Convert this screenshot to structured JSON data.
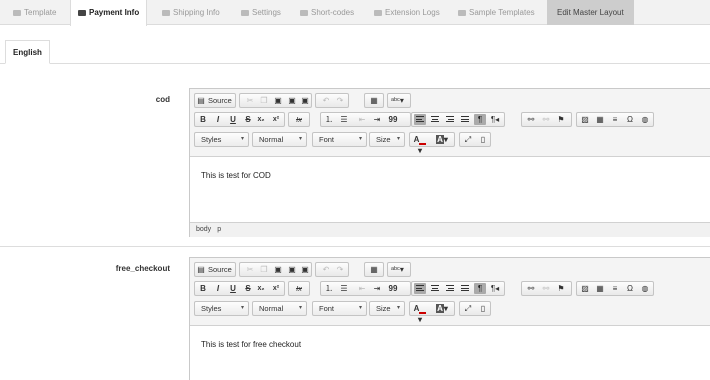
{
  "tabs": [
    {
      "label": "Template",
      "icon": "template-icon"
    },
    {
      "label": "Payment Info",
      "icon": "credit-card-icon"
    },
    {
      "label": "Shipping Info",
      "icon": "truck-icon"
    },
    {
      "label": "Settings",
      "icon": "gears-icon"
    },
    {
      "label": "Short-codes",
      "icon": "book-icon"
    },
    {
      "label": "Extension Logs",
      "icon": "calendar-icon"
    },
    {
      "label": "Sample Templates",
      "icon": "tag-icon"
    },
    {
      "label": "Edit Master Layout",
      "icon": ""
    }
  ],
  "active_tab": "Payment Info",
  "language_tab": "English",
  "toolbar": {
    "source_label": "Source",
    "styles_label": "Styles",
    "format_label": "Normal",
    "font_label": "Font",
    "size_label": "Size",
    "bold": "B",
    "italic": "I",
    "underline": "U",
    "strike": "S",
    "subscript": "x₂",
    "superscript": "x²",
    "remove_format": "Ix",
    "quote": "99",
    "omega": "Ω",
    "text_color": "A",
    "bg_color": "A"
  },
  "sections": [
    {
      "label": "cod",
      "content": "This is test for COD",
      "path": [
        "body",
        "p"
      ]
    },
    {
      "label": "free_checkout",
      "content": "This is test for free checkout",
      "path": []
    }
  ],
  "colors": {
    "text_color_swatch": "#cc0000",
    "bg_color_swatch": "#222222"
  }
}
